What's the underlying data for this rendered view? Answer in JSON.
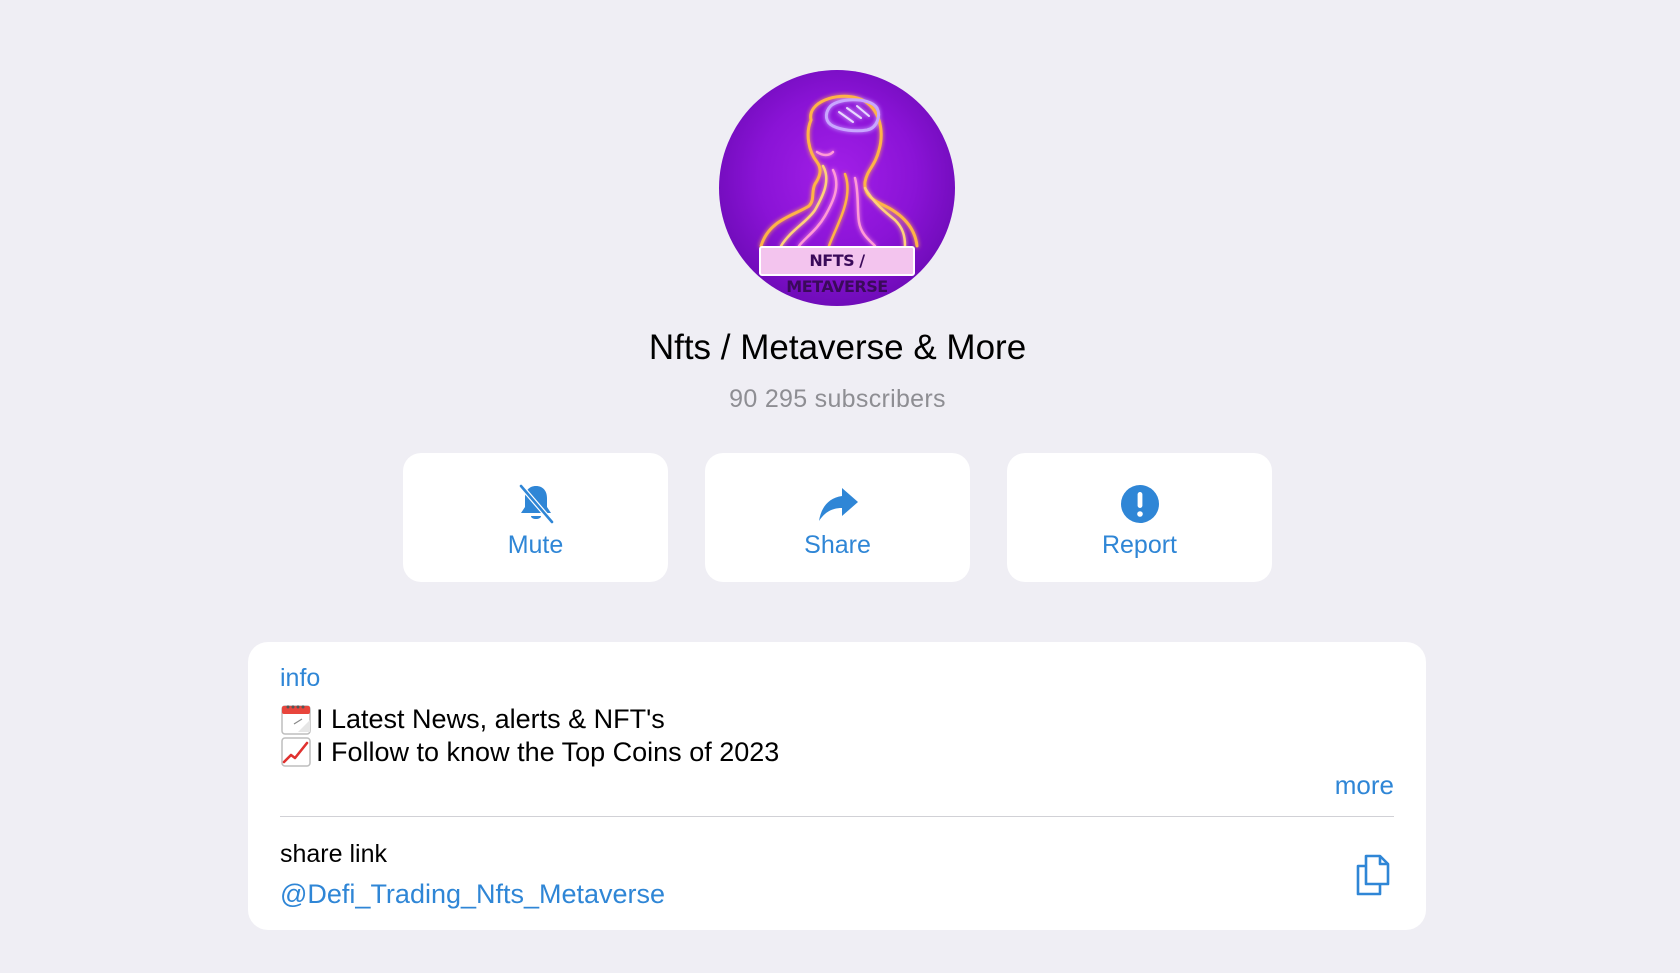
{
  "channel": {
    "avatar_badge": "NFTS / METAVERSE",
    "title": "Nfts / Metaverse & More",
    "subscribers": "90 295 subscribers"
  },
  "actions": {
    "mute": {
      "label": "Mute",
      "icon": "bell-slash-icon"
    },
    "share": {
      "label": "Share",
      "icon": "share-arrow-icon"
    },
    "report": {
      "label": "Report",
      "icon": "exclamation-circle-icon"
    }
  },
  "info": {
    "label": "info",
    "lines": [
      {
        "emoji": "calendar-emoji",
        "text": "I Latest News, alerts & NFT's"
      },
      {
        "emoji": "chart-increasing-emoji",
        "text": "I Follow to know the Top Coins of 2023"
      }
    ],
    "more": "more"
  },
  "share_link": {
    "title": "share link",
    "value": "@Defi_Trading_Nfts_Metaverse",
    "copy_icon": "copy-icon"
  },
  "colors": {
    "accent": "#2f86d6",
    "background": "#efeef4",
    "card": "#ffffff",
    "avatar_purple": "#8a13d6"
  }
}
